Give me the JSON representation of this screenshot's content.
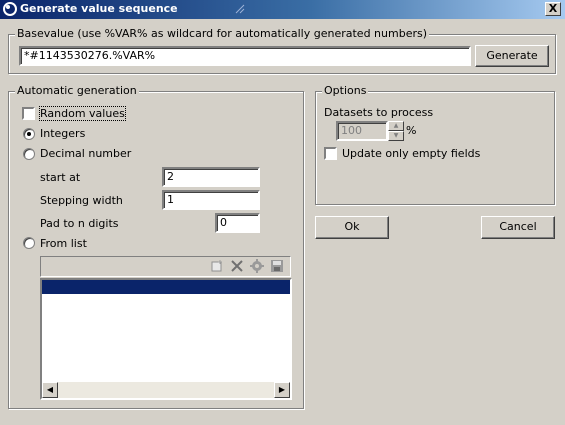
{
  "window": {
    "title": "Generate value sequence",
    "close_label": "X"
  },
  "basevalue": {
    "legend": "Basevalue (use %VAR% as wildcard for automatically generated numbers)",
    "value": "*#1143530276.%VAR%",
    "generate_label": "Generate"
  },
  "auto": {
    "legend": "Automatic generation",
    "random_label": "Random values",
    "random_checked": false,
    "integers_label": "Integers",
    "integers_selected": true,
    "decimal_label": "Decimal number",
    "start_label": "start at",
    "start_value": "2",
    "step_label": "Stepping width",
    "step_value": "1",
    "pad_label": "Pad to n digits",
    "pad_value": "0",
    "fromlist_label": "From list",
    "toolbar_icons": [
      "new-icon",
      "delete-icon",
      "gear-icon",
      "save-icon"
    ]
  },
  "options": {
    "legend": "Options",
    "datasets_label": "Datasets to process",
    "datasets_value": "100",
    "percent_label": "%",
    "empty_fields_label": "Update only empty fields",
    "empty_fields_checked": false
  },
  "buttons": {
    "ok_label": "Ok",
    "cancel_label": "Cancel"
  }
}
